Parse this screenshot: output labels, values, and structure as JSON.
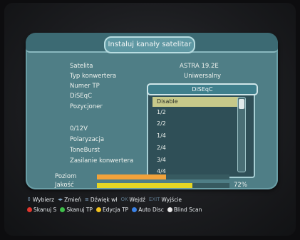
{
  "title": "Instaluj kanały satelitar",
  "fields": [
    {
      "label": "Satelita",
      "value": "ASTRA 19.2E"
    },
    {
      "label": "Typ konwertera",
      "value": "Uniwersalny"
    },
    {
      "label": "Numer TP",
      "value": ""
    },
    {
      "label": "DiSEqC",
      "value": ""
    },
    {
      "label": "Pozycjoner",
      "value": ""
    },
    {
      "label": "0/12V",
      "value": ""
    },
    {
      "label": "Polaryzacja",
      "value": ""
    },
    {
      "label": "ToneBurst",
      "value": ""
    },
    {
      "label": "Zasilanie konwertera",
      "value": ""
    }
  ],
  "dropdown": {
    "title": "DiSEqC",
    "options": [
      "Disable",
      "1/2",
      "2/2",
      "1/4",
      "2/4",
      "3/4",
      "4/4"
    ],
    "selected_index": 0
  },
  "meters": {
    "level": {
      "label": "Poziom",
      "value": 0.52,
      "color": "#f2a23a"
    },
    "quality": {
      "label": "Jakość",
      "value": 0.72,
      "pct_label": "72%",
      "color": "#e5d624"
    }
  },
  "hints": [
    {
      "key": "↕",
      "label": "Wybierz"
    },
    {
      "key": "◂▸",
      "label": "Zmień"
    },
    {
      "key": "≡",
      "label": "Dźwięk wł"
    },
    {
      "key": "OK",
      "label": "Wejdź",
      "dim_key": true
    },
    {
      "key": "EXIT",
      "label": "Wyjście",
      "dim_key": true
    }
  ],
  "color_buttons": [
    {
      "color": "#e2362d",
      "label": "Skanuj S"
    },
    {
      "color": "#3fbf4a",
      "label": "Skanuj TP"
    },
    {
      "color": "#f2c21e",
      "label": "Edycja TP"
    },
    {
      "color": "#3a82e6",
      "label": "Auto Disc"
    },
    {
      "color": "#e8e8e8",
      "label": "Blind Scan"
    }
  ]
}
